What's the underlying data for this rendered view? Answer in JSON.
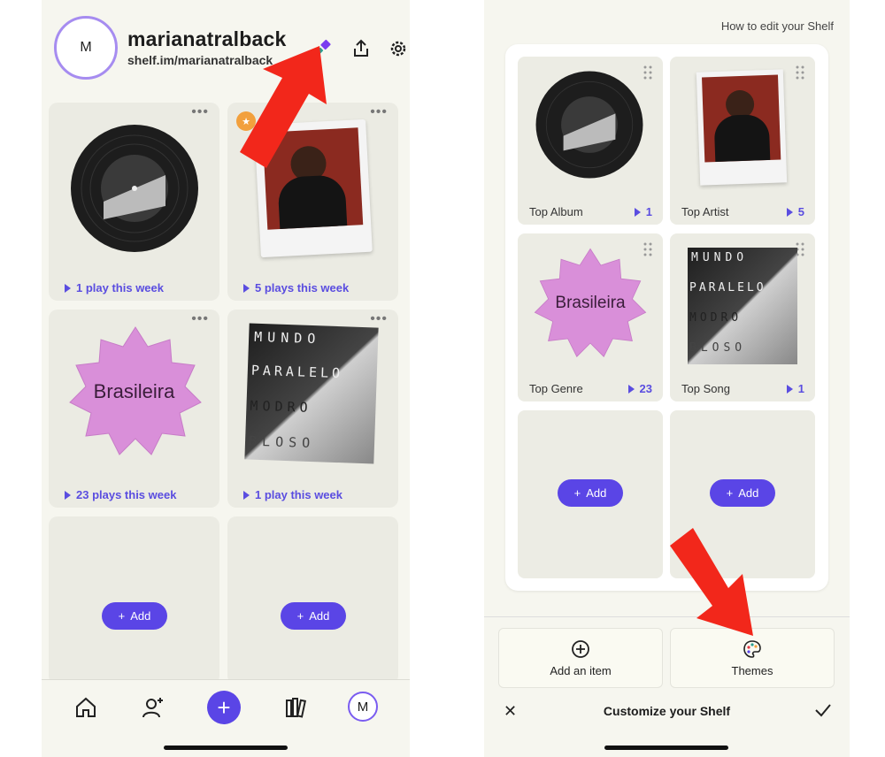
{
  "left": {
    "profile": {
      "avatar_letter": "M",
      "username": "marianatralback",
      "url": "shelf.im/marianatralback"
    },
    "cards": [
      {
        "plays": "1 play this week",
        "art": "vinyl-record"
      },
      {
        "plays": "5 plays this week",
        "art": "polaroid-portrait"
      },
      {
        "plays": "23 plays this week",
        "art": "genre-badge",
        "genre": "Brasileira"
      },
      {
        "plays": "1 play this week",
        "art": "album-cover",
        "cover_text": [
          "MUNDO",
          "PARALELO",
          "MODRO",
          "BLOSO"
        ]
      }
    ],
    "add_label": "Add",
    "nav": {
      "avatar_letter": "M"
    }
  },
  "right": {
    "help_link": "How to edit your Shelf",
    "cards": [
      {
        "label": "Top Album",
        "count": "1"
      },
      {
        "label": "Top Artist",
        "count": "5"
      },
      {
        "label": "Top Genre",
        "count": "23",
        "genre": "Brasileira"
      },
      {
        "label": "Top Song",
        "count": "1"
      }
    ],
    "add_label": "Add",
    "sheet": {
      "add_item": "Add an item",
      "themes": "Themes",
      "title": "Customize your Shelf"
    }
  },
  "colors": {
    "accent": "#5a45e6",
    "background": "#f6f6ef",
    "genre_badge": "#d98fd9",
    "arrow": "#f2271b"
  }
}
